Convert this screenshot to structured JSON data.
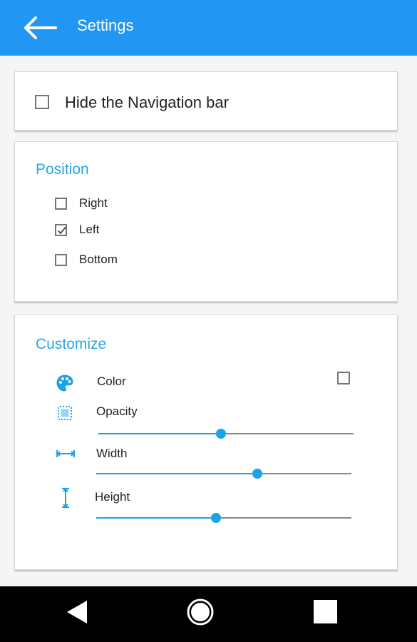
{
  "appbar": {
    "title": "Settings",
    "back_icon": "arrow-left-icon",
    "color": "#2196f3"
  },
  "hide_nav": {
    "label": "Hide the Navigation bar",
    "checked": false
  },
  "position": {
    "title": "Position",
    "options": [
      {
        "label": "Right",
        "checked": false
      },
      {
        "label": "Left",
        "checked": true
      },
      {
        "label": "Bottom",
        "checked": false
      }
    ]
  },
  "customize": {
    "title": "Customize",
    "color": {
      "label": "Color",
      "icon": "palette-icon",
      "checked": false
    },
    "opacity": {
      "label": "Opacity",
      "icon": "opacity-icon",
      "value": 0.48
    },
    "width": {
      "label": "Width",
      "icon": "width-icon",
      "value": 0.63
    },
    "height": {
      "label": "Height",
      "icon": "height-icon",
      "value": 0.47
    }
  },
  "accent_color": "#29a6e6",
  "system_nav": {
    "back_icon": "triangle-back-icon",
    "home_icon": "circle-home-icon",
    "recents_icon": "square-recents-icon"
  }
}
